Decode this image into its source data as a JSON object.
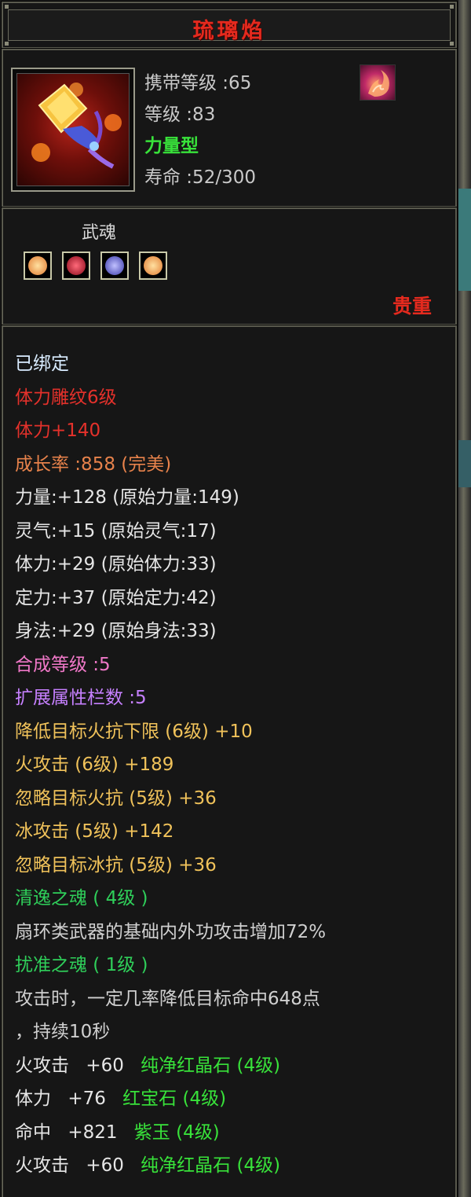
{
  "item": {
    "name": "琉璃焰",
    "carry_level": "携带等级 :65",
    "level": "等级 :83",
    "type": "力量型",
    "lifespan": "寿命 :52/300"
  },
  "soul": {
    "label": "武魂",
    "rarity": "贵重",
    "gems": [
      {
        "icon": "orange-gem-icon",
        "color": "#f4a25a"
      },
      {
        "icon": "red-gem-icon",
        "color": "#c8283a"
      },
      {
        "icon": "purple-gem-icon",
        "color": "#6a6ae8"
      },
      {
        "icon": "orange-gem-icon",
        "color": "#f4a25a"
      }
    ]
  },
  "details": [
    {
      "text": "已绑定",
      "color": "bind"
    },
    {
      "text": "体力雕纹6级",
      "color": "red"
    },
    {
      "text": "体力+140",
      "color": "red"
    },
    {
      "text": "成长率 :858 (完美)",
      "color": "orange"
    },
    {
      "text": "力量:+128 (原始力量:149)",
      "color": "white"
    },
    {
      "text": "灵气:+15 (原始灵气:17)",
      "color": "white"
    },
    {
      "text": "体力:+29 (原始体力:33)",
      "color": "white"
    },
    {
      "text": "定力:+37 (原始定力:42)",
      "color": "white"
    },
    {
      "text": "身法:+29 (原始身法:33)",
      "color": "white"
    },
    {
      "text": "合成等级 :5",
      "color": "pink"
    },
    {
      "text": "扩展属性栏数 :5",
      "color": "purple"
    },
    {
      "text": "降低目标火抗下限 (6级) +10",
      "color": "gold"
    },
    {
      "text": "火攻击 (6级) +189",
      "color": "gold"
    },
    {
      "text": "忽略目标火抗 (5级) +36",
      "color": "gold"
    },
    {
      "text": "冰攻击 (5级) +142",
      "color": "gold"
    },
    {
      "text": "忽略目标冰抗 (5级) +36",
      "color": "gold"
    },
    {
      "text": "清逸之魂 ( 4级 )",
      "color": "green"
    },
    {
      "text": "扇环类武器的基础内外功攻击增加72%",
      "color": "gray"
    },
    {
      "text": "扰准之魂 ( 1级 )",
      "color": "green"
    },
    {
      "text": "攻击时，一定几率降低目标命中648点",
      "color": "gray"
    },
    {
      "text": "，持续10秒",
      "color": "gray"
    }
  ],
  "gems_socketed": [
    {
      "stat": "火攻击",
      "value": "+60",
      "gem": "纯净红晶石 (4级)"
    },
    {
      "stat": "体力",
      "value": "+76",
      "gem": "红宝石 (4级)"
    },
    {
      "stat": "命中",
      "value": "+821",
      "gem": "紫玉 (4级)"
    },
    {
      "stat": "火攻击",
      "value": "+60",
      "gem": "纯净红晶石 (4级)"
    }
  ],
  "colors": {
    "title": "#e52a1e",
    "type_green": "#38e23a",
    "panel_border": "#5a5a4e"
  }
}
